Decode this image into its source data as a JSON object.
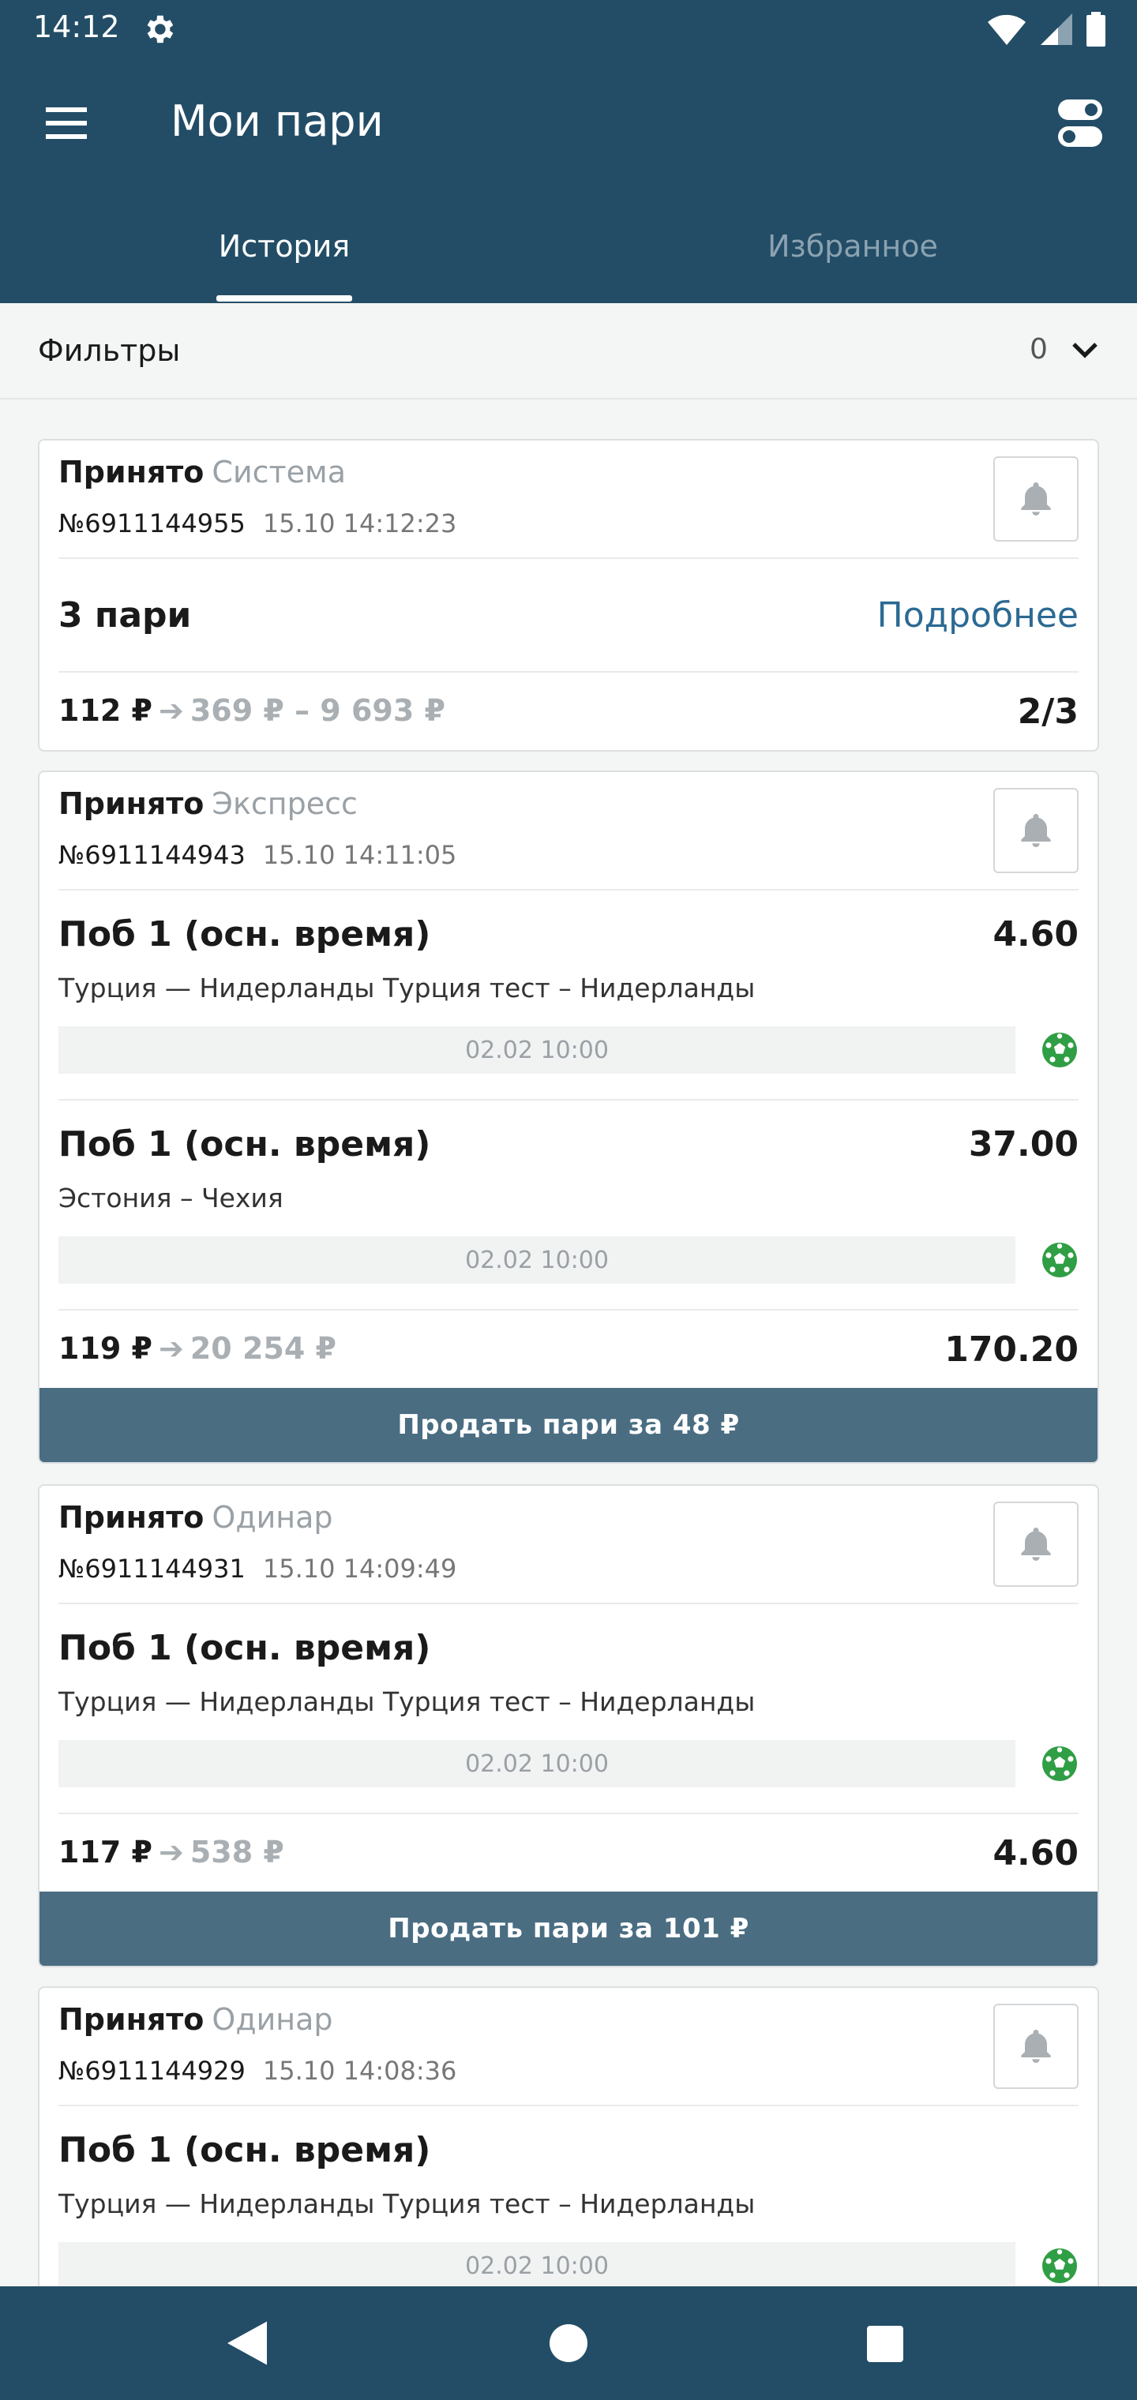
{
  "status_bar": {
    "time": "14:12"
  },
  "appbar": {
    "title": "Мои пари"
  },
  "tabs": [
    {
      "label": "История"
    },
    {
      "label": "Избранное"
    }
  ],
  "filters": {
    "label": "Фильтры",
    "count": "0"
  },
  "cards": [
    {
      "status": "Принято",
      "type": "Система",
      "id": "№6911144955",
      "date": "15.10 14:12:23",
      "summary": {
        "title": "3 пари",
        "link": "Подробнее"
      },
      "total": {
        "stake": "112 ₽",
        "arrow": "➔",
        "payout": "369 ₽ – 9 693 ₽",
        "odd": "2/3"
      }
    },
    {
      "status": "Принято",
      "type": "Экспресс",
      "id": "№6911144943",
      "date": "15.10 14:11:05",
      "events": [
        {
          "market": "Поб 1 (осн. время)",
          "odd": "4.60",
          "teams": "Турция — Нидерланды Турция тест – Нидерланды",
          "date": "02.02 10:00"
        },
        {
          "market": "Поб 1 (осн. время)",
          "odd": "37.00",
          "teams": "Эстония – Чехия",
          "date": "02.02 10:00"
        }
      ],
      "total": {
        "stake": "119 ₽",
        "arrow": "➔",
        "payout": "20 254 ₽",
        "odd": "170.20"
      },
      "sell": "Продать пари за 48 ₽"
    },
    {
      "status": "Принято",
      "type": "Одинар",
      "id": "№6911144931",
      "date": "15.10 14:09:49",
      "events": [
        {
          "market": "Поб 1 (осн. время)",
          "odd": "",
          "teams": "Турция — Нидерланды Турция тест – Нидерланды",
          "date": "02.02 10:00"
        }
      ],
      "total": {
        "stake": "117 ₽",
        "arrow": "➔",
        "payout": "538 ₽",
        "odd": "4.60"
      },
      "sell": "Продать пари за 101 ₽"
    },
    {
      "status": "Принято",
      "type": "Одинар",
      "id": "№6911144929",
      "date": "15.10 14:08:36",
      "events": [
        {
          "market": "Поб 1 (осн. время)",
          "odd": "",
          "teams": "Турция — Нидерланды Турция тест – Нидерланды",
          "date": "02.02 10:00"
        }
      ]
    }
  ],
  "icons": {
    "settings": "gear-icon",
    "wifi": "wifi-icon",
    "signal": "signal-icon",
    "battery": "battery-icon",
    "menu": "menu-icon",
    "toggle": "toggle-icon",
    "chevron": "chevron-down-icon",
    "bell": "bell-icon",
    "sport": "soccer-ball-icon",
    "nav": [
      "back-icon",
      "home-icon",
      "recents-icon"
    ]
  },
  "colors": {
    "primary": "#234d66",
    "sell_button": "#4a6d82",
    "link": "#2b6a93",
    "muted": "#9aa1a6"
  }
}
